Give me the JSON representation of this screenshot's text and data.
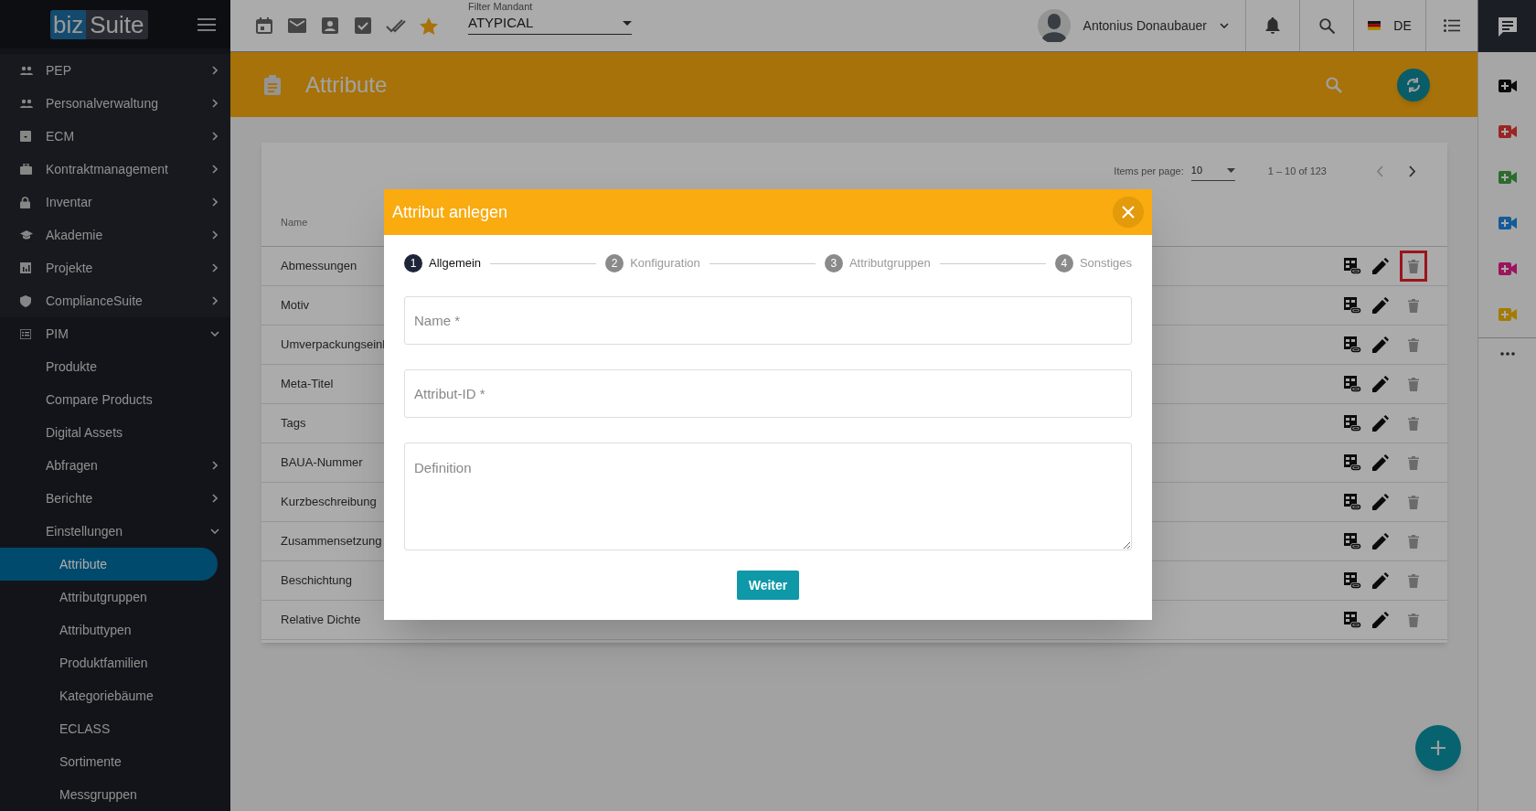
{
  "logo": {
    "part_1": "biz",
    "part_2": "Suite"
  },
  "filter": {
    "label": "Filter Mandant",
    "value": "ATYPICAL"
  },
  "user": {
    "name": "Antonius Donaubauer"
  },
  "language": "DE",
  "sidebar": {
    "items": [
      {
        "label": "PEP",
        "expanded": false,
        "selected": false
      },
      {
        "label": "Personalverwaltung",
        "expanded": false,
        "selected": false
      },
      {
        "label": "ECM",
        "expanded": false,
        "selected": false
      },
      {
        "label": "Kontraktmanagement",
        "expanded": false,
        "selected": false
      },
      {
        "label": "Inventar",
        "expanded": false,
        "selected": false
      },
      {
        "label": "Akademie",
        "expanded": false,
        "selected": false
      },
      {
        "label": "Projekte",
        "expanded": false,
        "selected": false
      },
      {
        "label": "ComplianceSuite",
        "expanded": false,
        "selected": false
      },
      {
        "label": "PIM",
        "expanded": true,
        "selected": false,
        "children": [
          {
            "label": "Produkte",
            "selected": false
          },
          {
            "label": "Compare Products",
            "selected": false
          },
          {
            "label": "Digital Assets",
            "selected": false
          },
          {
            "label": "Abfragen",
            "expanded": false,
            "selected": false
          },
          {
            "label": "Berichte",
            "expanded": false,
            "selected": false
          },
          {
            "label": "Einstellungen",
            "expanded": true,
            "selected": false,
            "children": [
              {
                "label": "Attribute",
                "selected": true
              },
              {
                "label": "Attributgruppen",
                "selected": false
              },
              {
                "label": "Attributtypen",
                "selected": false
              },
              {
                "label": "Produktfamilien",
                "selected": false
              },
              {
                "label": "Kategoriebäume",
                "selected": false
              },
              {
                "label": "ECLASS",
                "selected": false
              },
              {
                "label": "Sortimente",
                "selected": false
              },
              {
                "label": "Messgruppen",
                "selected": false
              }
            ]
          }
        ]
      }
    ]
  },
  "page_header": {
    "title": "Attribute"
  },
  "table": {
    "pagination": {
      "label": "Items per page:",
      "page_size": "10",
      "range": "1 – 10 of 123",
      "previous_disabled": true,
      "next_disabled": false
    },
    "columns": [
      "Name"
    ],
    "rows": [
      {
        "name": "Abmessungen",
        "highlighted": true,
        "delete_disabled": true
      },
      {
        "name": "Motiv",
        "highlighted": false,
        "delete_disabled": true
      },
      {
        "name": "Umverpackungseinl",
        "highlighted": false,
        "delete_disabled": true
      },
      {
        "name": "Meta-Titel",
        "highlighted": false,
        "delete_disabled": true
      },
      {
        "name": "Tags",
        "highlighted": false,
        "delete_disabled": true
      },
      {
        "name": "BAUA-Nummer",
        "highlighted": false,
        "delete_disabled": true
      },
      {
        "name": "Kurzbeschreibung",
        "highlighted": false,
        "delete_disabled": true
      },
      {
        "name": "Zusammensetzung",
        "highlighted": false,
        "delete_disabled": true
      },
      {
        "name": "Beschichtung",
        "highlighted": false,
        "delete_disabled": true
      },
      {
        "name": "Relative Dichte",
        "highlighted": false,
        "delete_disabled": true
      }
    ]
  },
  "right_rail": {
    "video_buttons": [
      {
        "color": "#0b0b0b"
      },
      {
        "color": "#992623"
      },
      {
        "color": "#2d6b2f"
      },
      {
        "color": "#145b99"
      },
      {
        "color": "#9c145e"
      },
      {
        "color": "#a47b00"
      }
    ]
  },
  "modal": {
    "title": "Attribut anlegen",
    "steps": [
      {
        "number": "1",
        "label": "Allgemein",
        "selected": true
      },
      {
        "number": "2",
        "label": "Konfiguration",
        "selected": false
      },
      {
        "number": "3",
        "label": "Attributgruppen",
        "selected": false
      },
      {
        "number": "4",
        "label": "Sonstiges",
        "selected": false
      }
    ],
    "fields": [
      {
        "kind": "input",
        "placeholder": "Name *"
      },
      {
        "kind": "input",
        "placeholder": "Attribut-ID *"
      },
      {
        "kind": "textarea",
        "placeholder": "Definition"
      }
    ],
    "button": "Weiter"
  }
}
